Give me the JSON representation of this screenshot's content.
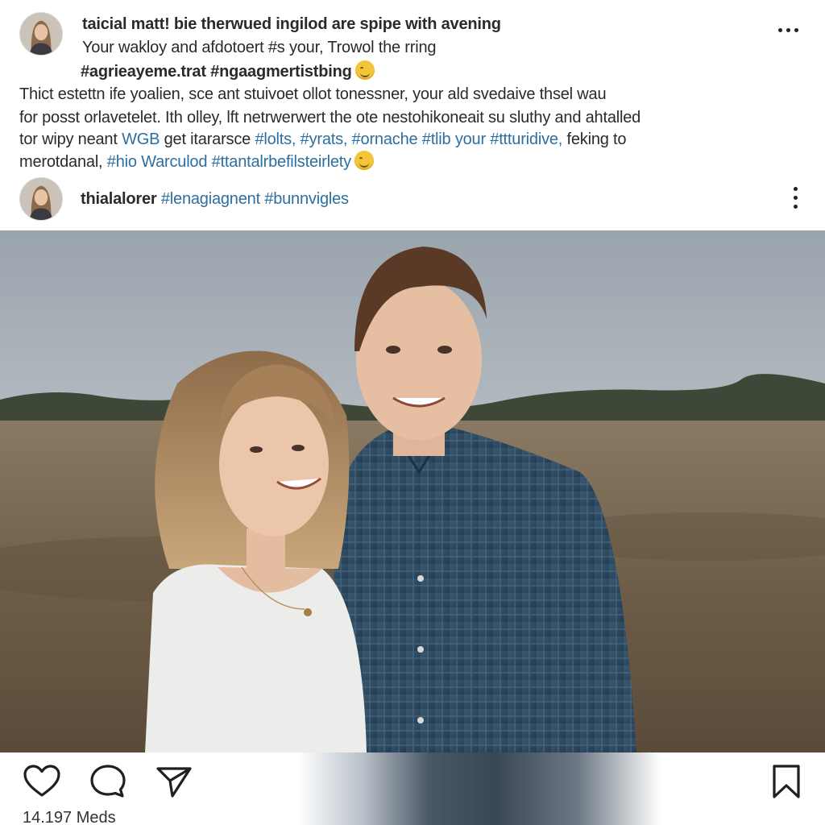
{
  "post": {
    "caption": {
      "line1": "taicial matt! bie therwued ingilod are spipe with avening",
      "line2": "Your wakloy and afdotoert #s your, Trowol the rring",
      "line3": "#agrieayeme.trat #ngaagmertistbing",
      "line4": "Thict estettn ife yoalien, sce ant stuivoet ollot tonessner, your ald svedaive thsel wau",
      "line5": "for posst orlavetelet. Ith olley, lft netrwerwert the ote nestohikoneait su sluthy and ahtalled",
      "line6_text": "tor wipy neant",
      "line6_tags": "WGB",
      "line6_text2": "get itararsce",
      "line6_tags2": "#lolts, #yrats, #ornache #tlib your #ttturidive,",
      "line6_text3": "feking to",
      "line7_text": "merotdanal,",
      "line7_tags": "#hio Warculod #ttantalrbefilsteirlety"
    },
    "second_row": {
      "username": "thialalorer",
      "tags": "#lenagiagnent #bunnvigles"
    },
    "stats": {
      "likes_text": "14.197 Meds"
    }
  },
  "icons": {
    "more_top": "more-horizontal-icon",
    "more_row": "more-vertical-icon",
    "like": "heart-icon",
    "comment": "comment-icon",
    "share": "paper-plane-icon",
    "save": "bookmark-icon",
    "emoji": "grinning-face-emoji"
  },
  "colors": {
    "hashtag": "#2d6fa0",
    "text": "#2a2a2a",
    "background": "#ffffff"
  }
}
